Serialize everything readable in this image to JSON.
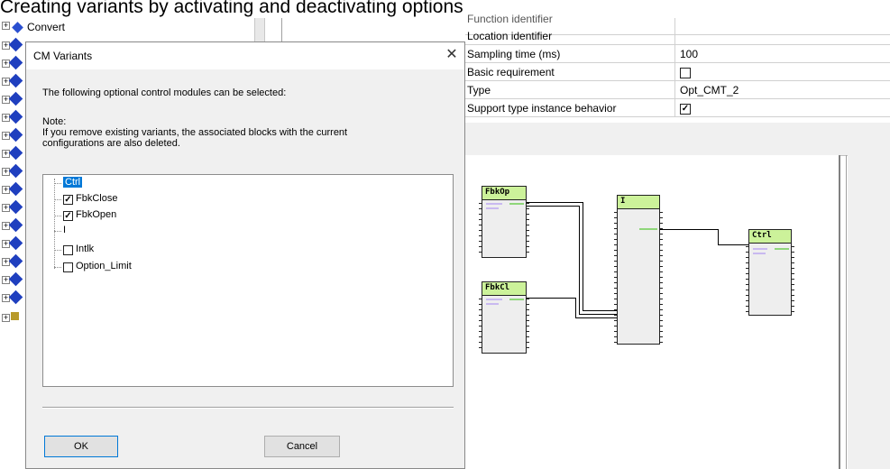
{
  "caption": "Creating variants by activating and deactivating options",
  "left_tree": {
    "items": [
      {
        "label": "Convert",
        "icon": "blue-diamond-icon"
      }
    ]
  },
  "dialog": {
    "title": "CM Variants",
    "intro": "The following optional control modules can be selected:",
    "note_heading": "Note:",
    "note_line1": "If you remove existing variants, the associated blocks with the current",
    "note_line2": "configurations are also deleted.",
    "tree": [
      {
        "label": "Ctrl",
        "selected": true,
        "checkbox": false
      },
      {
        "label": "FbkClose",
        "checked": true,
        "checkbox": true
      },
      {
        "label": "FbkOpen",
        "checked": true,
        "checkbox": true
      },
      {
        "label": "I",
        "checkbox": false
      },
      {
        "label": "Intlk",
        "checked": false,
        "checkbox": true
      },
      {
        "label": "Option_Limit",
        "checked": false,
        "checkbox": true
      }
    ],
    "ok_label": "OK",
    "cancel_label": "Cancel",
    "check_mark": "✓"
  },
  "properties": {
    "rows": [
      {
        "name": "Function identifier",
        "value": ""
      },
      {
        "name": "Location identifier",
        "value": ""
      },
      {
        "name": "Sampling time (ms)",
        "value": "100"
      },
      {
        "name": "Basic requirement",
        "value": "",
        "checkbox": true,
        "checked": false
      },
      {
        "name": "Type",
        "value": "Opt_CMT_2"
      },
      {
        "name": "Support type instance behavior",
        "value": "",
        "checkbox": true,
        "checked": true
      }
    ]
  },
  "diagram": {
    "blocks": [
      {
        "name": "FbkOp"
      },
      {
        "name": "FbkCl"
      },
      {
        "name": "I"
      },
      {
        "name": "Ctrl"
      }
    ],
    "header_color": "#ccf29a"
  }
}
